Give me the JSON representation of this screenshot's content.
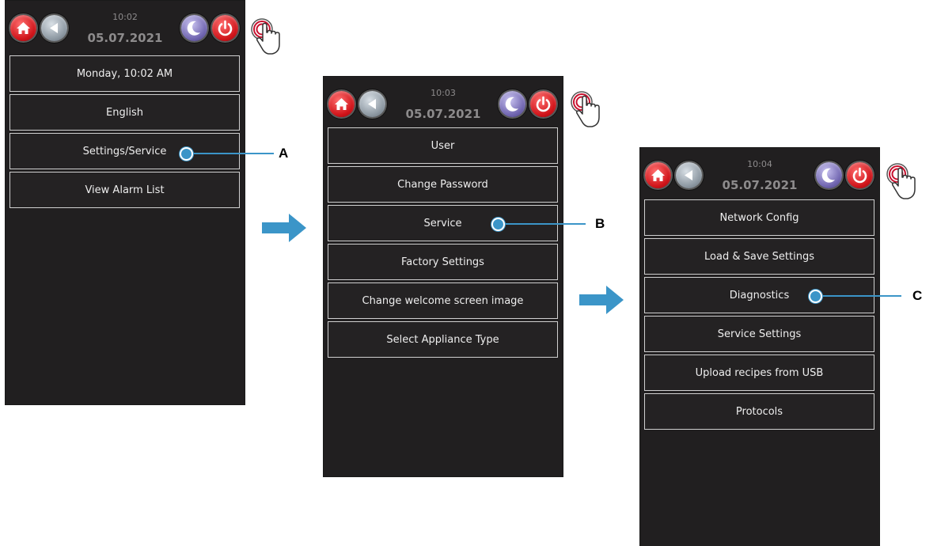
{
  "screens": [
    {
      "time": "10:02",
      "date": "05.07.2021",
      "menu_items": [
        "Monday, 10:02 AM",
        "English",
        "Settings/Service",
        "View Alarm List"
      ]
    },
    {
      "time": "10:03",
      "date": "05.07.2021",
      "menu_items": [
        "User",
        "Change Password",
        "Service",
        "Factory Settings",
        "Change welcome screen image",
        "Select Appliance Type"
      ]
    },
    {
      "time": "10:04",
      "date": "05.07.2021",
      "menu_items": [
        "Network Config",
        "Load  & Save Settings",
        "Diagnostics",
        "Service Settings",
        "Upload recipes from USB",
        "Protocols"
      ]
    }
  ],
  "callouts": [
    "A",
    "B",
    "C"
  ],
  "icons": {
    "home": "home-icon",
    "back": "back-arrow-icon",
    "sleep": "moon-icon",
    "power": "power-icon",
    "tap": "tap-hand-icon",
    "step_arrow": "arrow-right-icon"
  },
  "colors": {
    "screen_bg": "#211f20",
    "callout": "#3b95c8",
    "arrow": "#3b95c8",
    "red_button": "#d0141a"
  }
}
